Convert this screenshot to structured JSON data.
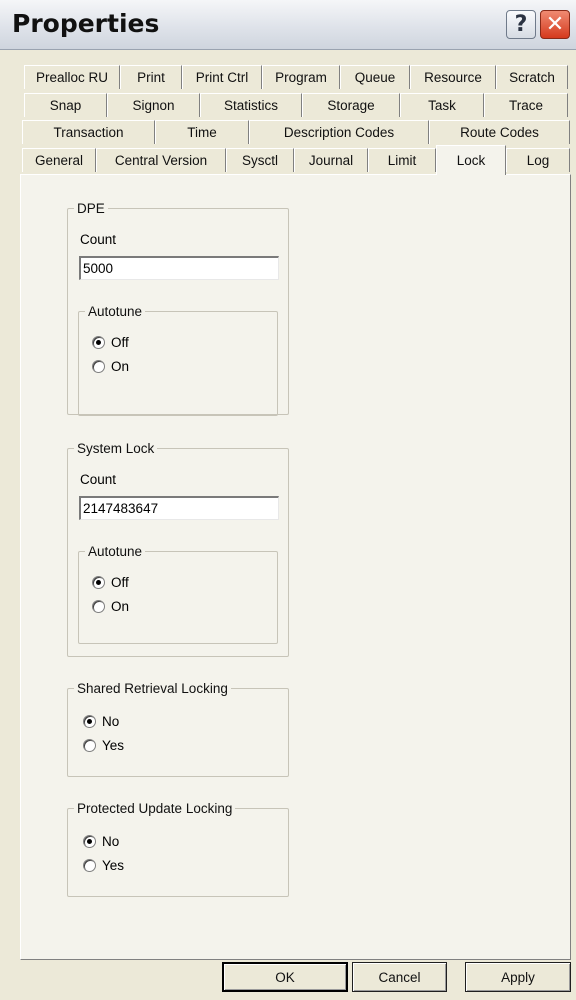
{
  "window": {
    "title": "Properties",
    "help_label": "?",
    "close_label": "✕"
  },
  "tabs": {
    "row1": [
      "Prealloc RU",
      "Print",
      "Print Ctrl",
      "Program",
      "Queue",
      "Resource",
      "Scratch"
    ],
    "row2": [
      "Snap",
      "Signon",
      "Statistics",
      "Storage",
      "Task",
      "Trace"
    ],
    "row3": [
      "Transaction",
      "Time",
      "Description Codes",
      "Route Codes"
    ],
    "row4": [
      "General",
      "Central Version",
      "Sysctl",
      "Journal",
      "Limit",
      "Lock",
      "Log"
    ],
    "active": "Lock"
  },
  "dpe": {
    "legend": "DPE",
    "count_label": "Count",
    "count_value": "5000",
    "autotune": {
      "legend": "Autotune",
      "off_label": "Off",
      "on_label": "On",
      "selected": "Off"
    }
  },
  "system_lock": {
    "legend": "System Lock",
    "count_label": "Count",
    "count_value": "2147483647",
    "autotune": {
      "legend": "Autotune",
      "off_label": "Off",
      "on_label": "On",
      "selected": "Off"
    }
  },
  "shared_retrieval": {
    "legend": "Shared Retrieval Locking",
    "no_label": "No",
    "yes_label": "Yes",
    "selected": "No"
  },
  "protected_update": {
    "legend": "Protected Update Locking",
    "no_label": "No",
    "yes_label": "Yes",
    "selected": "No"
  },
  "buttons": {
    "ok": "OK",
    "cancel": "Cancel",
    "apply": "Apply"
  },
  "colors": {
    "dialog_bg": "#ece9d8",
    "panel_bg": "#f4f3ec",
    "close_red": "#d5391d"
  }
}
